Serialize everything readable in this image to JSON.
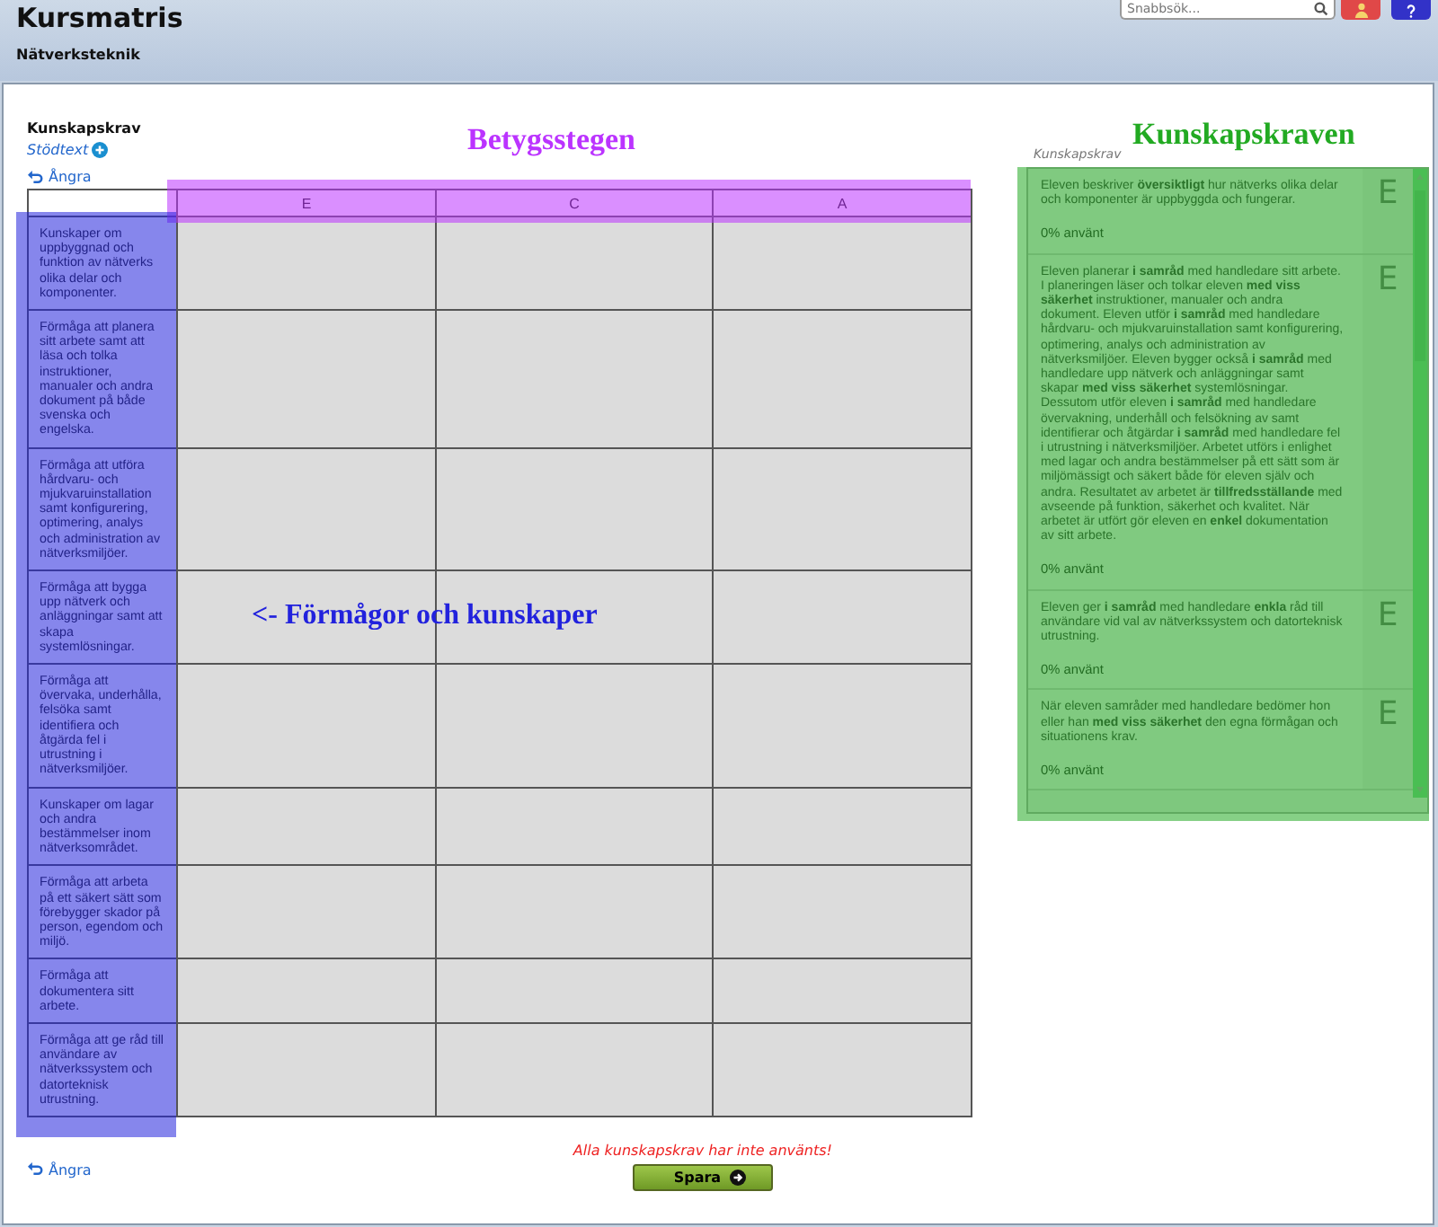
{
  "header": {
    "title": "Kursmatris",
    "subtitle": "Nätverksteknik",
    "search": {
      "placeholder": "Snabbsök..."
    }
  },
  "left": {
    "heading": "Kunskapskrav",
    "help_link": "Stödtext",
    "undo_top": "Ångra",
    "undo_bottom": "Ångra"
  },
  "table": {
    "columns": [
      "E",
      "C",
      "A"
    ],
    "rows": [
      {
        "label": "Kunskaper om uppbyggnad och funktion av nätverks olika delar och komponenter."
      },
      {
        "label": "Förmåga att planera sitt arbete samt att läsa och tolka instruktioner, manualer och andra dokument på både svenska och engelska."
      },
      {
        "label": "Förmåga att utföra hårdvaru- och mjukvaruinstallation samt konfigurering, optimering, analys och administration av nätverksmiljöer."
      },
      {
        "label": "Förmåga att bygga upp nätverk och anläggningar samt att skapa systemlösningar."
      },
      {
        "label": "Förmåga att övervaka, underhålla, felsöka samt identifiera och åtgärda fel i utrustning i nätverksmiljöer."
      },
      {
        "label": "Kunskaper om lagar och andra bestämmelser inom nätverksområdet."
      },
      {
        "label": "Förmåga att arbeta på ett säkert sätt som förebygger skador på person, egendom och miljö."
      },
      {
        "label": "Förmåga att dokumentera sitt arbete."
      },
      {
        "label": "Förmåga att ge råd till användare av nätverkssystem och datorteknisk utrustning."
      }
    ]
  },
  "criteria": {
    "heading": "Kunskapskrav",
    "items": [
      {
        "text": "Eleven beskriver **översiktligt** hur nätverks olika delar och komponenter är uppbyggda och fungerar.",
        "grade": "E",
        "usage": "0% använt"
      },
      {
        "text": "Eleven planerar **i samråd** med handledare sitt arbete. I planeringen läser och tolkar eleven **med viss säkerhet** instruktioner, manualer och andra dokument. Eleven utför **i samråd** med handledare hårdvaru- och mjukvaruinstallation samt konfigurering, optimering, analys och administration av nätverksmiljöer. Eleven bygger också **i samråd** med handledare upp nätverk och anläggningar samt skapar **med viss säkerhet** systemlösningar. Dessutom utför eleven **i samråd** med handledare övervakning, underhåll och felsökning av samt identifierar och åtgärdar **i samråd** med handledare fel i utrustning i nätverksmiljöer. Arbetet utförs i enlighet med lagar och andra bestämmelser på ett sätt som är miljömässigt och säkert både för eleven själv och andra. Resultatet av arbetet är **tillfredsställande** med avseende på funktion, säkerhet och kvalitet. När arbetet är utfört gör eleven en **enkel** dokumentation av sitt arbete.",
        "grade": "E",
        "usage": "0% använt"
      },
      {
        "text": "Eleven ger **i samråd** med handledare **enkla** råd till användare vid val av nätverkssystem och datorteknisk utrustning.",
        "grade": "E",
        "usage": "0% använt"
      },
      {
        "text": "När eleven samråder med handledare bedömer hon eller han **med viss säkerhet** den egna förmågan och situationens krav.",
        "grade": "E",
        "usage": "0% använt"
      }
    ]
  },
  "footer": {
    "warning": "Alla kunskapskrav har inte använts!",
    "save_button": "Spara"
  },
  "annotations": [
    {
      "kind": "grades",
      "label": "Betygsstegen",
      "color": "#bb33ff"
    },
    {
      "kind": "criteria",
      "label": "Kunskapskraven",
      "color": "#22aa22"
    },
    {
      "kind": "abilities",
      "label": "<- Förmågor och kunskaper",
      "color": "#2222dd"
    }
  ]
}
